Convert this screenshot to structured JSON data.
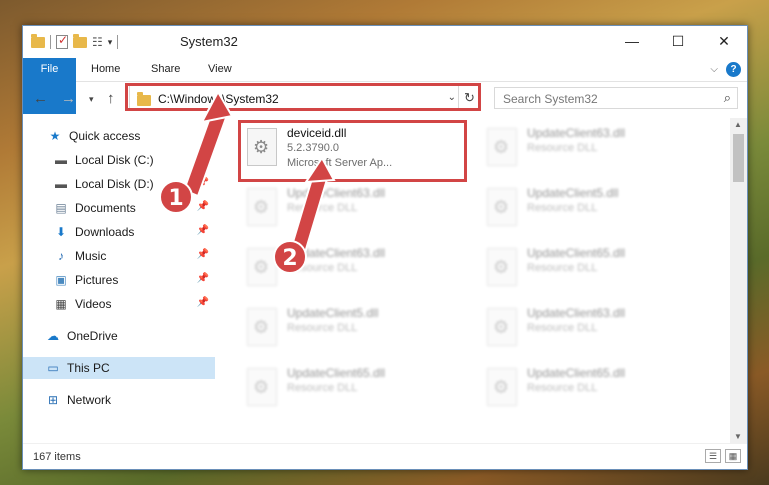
{
  "window": {
    "title": "System32",
    "controls": {
      "minimize": "—",
      "maximize": "☐",
      "close": "✕"
    }
  },
  "ribbon": {
    "tabs": [
      "File",
      "Home",
      "Share",
      "View"
    ],
    "help": "?"
  },
  "address": {
    "path": "C:\\Windows\\System32",
    "search_placeholder": "Search System32"
  },
  "sidebar": {
    "items": [
      {
        "label": "Quick access",
        "icon": "star-icon"
      },
      {
        "label": "Local Disk (C:)",
        "icon": "drive-icon",
        "pinned": true
      },
      {
        "label": "Local Disk (D:)",
        "icon": "drive-icon",
        "pinned": true
      },
      {
        "label": "Documents",
        "icon": "documents-icon",
        "pinned": true
      },
      {
        "label": "Downloads",
        "icon": "downloads-icon",
        "pinned": true
      },
      {
        "label": "Music",
        "icon": "music-icon",
        "pinned": true
      },
      {
        "label": "Pictures",
        "icon": "pictures-icon",
        "pinned": true
      },
      {
        "label": "Videos",
        "icon": "videos-icon",
        "pinned": true
      },
      {
        "label": "OneDrive",
        "icon": "cloud-icon"
      },
      {
        "label": "This PC",
        "icon": "computer-icon",
        "selected": true
      },
      {
        "label": "Network",
        "icon": "network-icon"
      }
    ]
  },
  "files": [
    {
      "name": "deviceid.dll",
      "line2": "5.2.3790.0",
      "line3": "Microsoft Server Ap..."
    },
    {
      "name": "UpdateClient63.dll",
      "line2": "Resource DLL"
    },
    {
      "name": "UpdateClient63.dll",
      "line2": "Resource DLL"
    },
    {
      "name": "UpdateClient5.dll",
      "line2": "Resource DLL"
    },
    {
      "name": "UpdateClient63.dll",
      "line2": "Resource DLL"
    },
    {
      "name": "UpdateClient65.dll",
      "line2": "Resource DLL"
    },
    {
      "name": "UpdateClient5.dll",
      "line2": "Resource DLL"
    },
    {
      "name": "UpdateClient63.dll",
      "line2": "Resource DLL"
    },
    {
      "name": "UpdateClient65.dll",
      "line2": "Resource DLL"
    },
    {
      "name": "UpdateClient65.dll",
      "line2": "Resource DLL"
    }
  ],
  "status": {
    "item_count": "167 items"
  },
  "callouts": [
    "1",
    "2"
  ],
  "colors": {
    "accent": "#1979ca",
    "highlight": "#d24545",
    "selected_bg": "#cce4f7"
  }
}
